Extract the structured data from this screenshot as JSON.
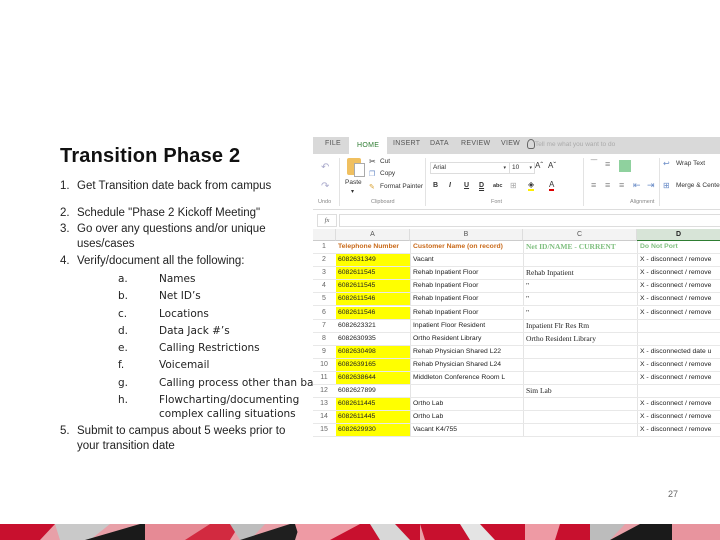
{
  "slide": {
    "title": "Transition Phase 2",
    "page_number": "27",
    "steps": [
      {
        "num": "1.",
        "text": "Get Transition date back from campus"
      },
      {
        "num": "2.",
        "text": "Schedule \"Phase 2 Kickoff Meeting\""
      },
      {
        "num": "3.",
        "text": "Go over any questions and/or unique",
        "text2": "uses/cases"
      },
      {
        "num": "4.",
        "text": "Verify/document all the following:"
      },
      {
        "num": "5.",
        "text": "Submit to campus about 5 weeks prior to",
        "text2": "your transition date"
      }
    ],
    "substeps": [
      {
        "letter": "a.",
        "text": "Names"
      },
      {
        "letter": "b.",
        "text": "Net ID’s"
      },
      {
        "letter": "c.",
        "text": "Locations"
      },
      {
        "letter": "d.",
        "text": "Data Jack #’s"
      },
      {
        "letter": "e.",
        "text": "Calling Restrictions"
      },
      {
        "letter": "f.",
        "text": "Voicemail"
      },
      {
        "letter": "g.",
        "text": "Calling process other than basic"
      },
      {
        "letter": "h.",
        "text": "Flowcharting/documenting",
        "text2": "complex calling situations"
      }
    ]
  },
  "excel": {
    "tabs": [
      "FILE",
      "HOME",
      "INSERT",
      "DATA",
      "REVIEW",
      "VIEW"
    ],
    "active_tab": "HOME",
    "tell_me_placeholder": "Tell me what you want to do",
    "ribbon": {
      "undo_label": "Undo",
      "paste_label": "Paste",
      "cut_label": "Cut",
      "copy_label": "Copy",
      "format_painter_label": "Format Painter",
      "clipboard_label": "Clipboard",
      "font_name": "Arial",
      "font_size": "10",
      "font_label": "Font",
      "bold": "B",
      "italic": "I",
      "underline": "U",
      "double_underline": "D",
      "strikethrough": "abc",
      "grow_font": "Aˆ",
      "shrink_font": "Aˇ",
      "wrap_text_label": "Wrap Text",
      "merge_center_label": "Merge & Center",
      "alignment_label": "Alignment",
      "accent_color": "#2e7d32"
    },
    "formula_bar": {
      "fx_label": "fx",
      "value": ""
    },
    "columns": [
      "A",
      "B",
      "C",
      "D"
    ],
    "selected_column": "D",
    "header_row": {
      "row": "1",
      "A": "Telephone Number",
      "B": "Customer Name (on record)",
      "C": "Net ID/NAME - CURRENT",
      "D": "Do Not Port"
    },
    "rows": [
      {
        "row": "2",
        "A": "6082631349",
        "B": "Vacant",
        "C": "",
        "D": "X - disconnect / remove",
        "yellow": true
      },
      {
        "row": "3",
        "A": "6082611545",
        "B": "Rehab Inpatient Floor",
        "C": "Rehab Inpatient",
        "D": "X - disconnect / remove",
        "yellow": true
      },
      {
        "row": "4",
        "A": "6082611545",
        "B": "Rehab Inpatient Floor",
        "C": "\"",
        "D": "X - disconnect / remove",
        "yellow": true
      },
      {
        "row": "5",
        "A": "6082611546",
        "B": "Rehab Inpatient Floor",
        "C": "\"",
        "D": "X - disconnect / remove",
        "yellow": true
      },
      {
        "row": "6",
        "A": "6082611546",
        "B": "Rehab Inpatient Floor",
        "C": "\"",
        "D": "X - disconnect / remove",
        "yellow": true
      },
      {
        "row": "7",
        "A": "6082623321",
        "B": "Inpatient Floor Resident",
        "C": "Inpatient Flr Res Rm",
        "D": "",
        "yellow": false
      },
      {
        "row": "8",
        "A": "6082630935",
        "B": "Ortho Resident Library",
        "C": "Ortho Resident Library",
        "D": "",
        "yellow": false
      },
      {
        "row": "9",
        "A": "6082630498",
        "B": "Rehab Physician Shared L22",
        "C": "",
        "D": "X - disconnected date u",
        "yellow": true
      },
      {
        "row": "10",
        "A": "6082639165",
        "B": "Rehab Physician Shared L24",
        "C": "",
        "D": "X - disconnect / remove",
        "yellow": true
      },
      {
        "row": "11",
        "A": "6082638644",
        "B": "Middleton Conference Room L",
        "C": "",
        "D": "X - disconnect / remove",
        "yellow": true
      },
      {
        "row": "12",
        "A": "6082627899",
        "B": "",
        "C": "Sim Lab",
        "D": "",
        "yellow": false
      },
      {
        "row": "13",
        "A": "6082611445",
        "B": "Ortho Lab",
        "C": "",
        "D": "X - disconnect / remove",
        "yellow": true
      },
      {
        "row": "14",
        "A": "6082611445",
        "B": "Ortho Lab",
        "C": "",
        "D": "X - disconnect / remove",
        "yellow": true
      },
      {
        "row": "15",
        "A": "6082629930",
        "B": "Vacant K4/755",
        "C": "",
        "D": "X - disconnect / remove",
        "yellow": true
      }
    ]
  }
}
